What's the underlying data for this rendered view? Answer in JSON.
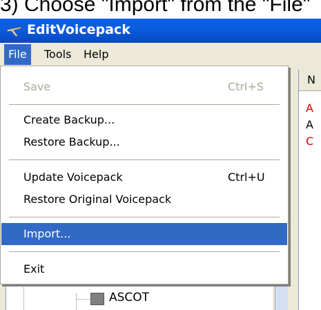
{
  "caption": "3) Choose \"Import\" from the \"File\"",
  "window": {
    "title": "EditVoicepack"
  },
  "menubar": {
    "items": [
      "File",
      "Tools",
      "Help"
    ]
  },
  "file_menu": {
    "save": {
      "label": "Save",
      "shortcut": "Ctrl+S"
    },
    "create_backup": {
      "label": "Create Backup..."
    },
    "restore_backup": {
      "label": "Restore Backup..."
    },
    "update_voicepack": {
      "label": "Update Voicepack",
      "shortcut": "Ctrl+U"
    },
    "restore_original": {
      "label": "Restore Original Voicepack"
    },
    "import": {
      "label": "Import..."
    },
    "exit": {
      "label": "Exit"
    }
  },
  "tree": {
    "visible_node": "ASCOT"
  },
  "list": {
    "header": "N",
    "rows": [
      "A",
      "A",
      "C"
    ]
  },
  "colors": {
    "title_bar": "#0a5ee8",
    "highlight": "#316ac5",
    "list_red": "#e00000"
  }
}
